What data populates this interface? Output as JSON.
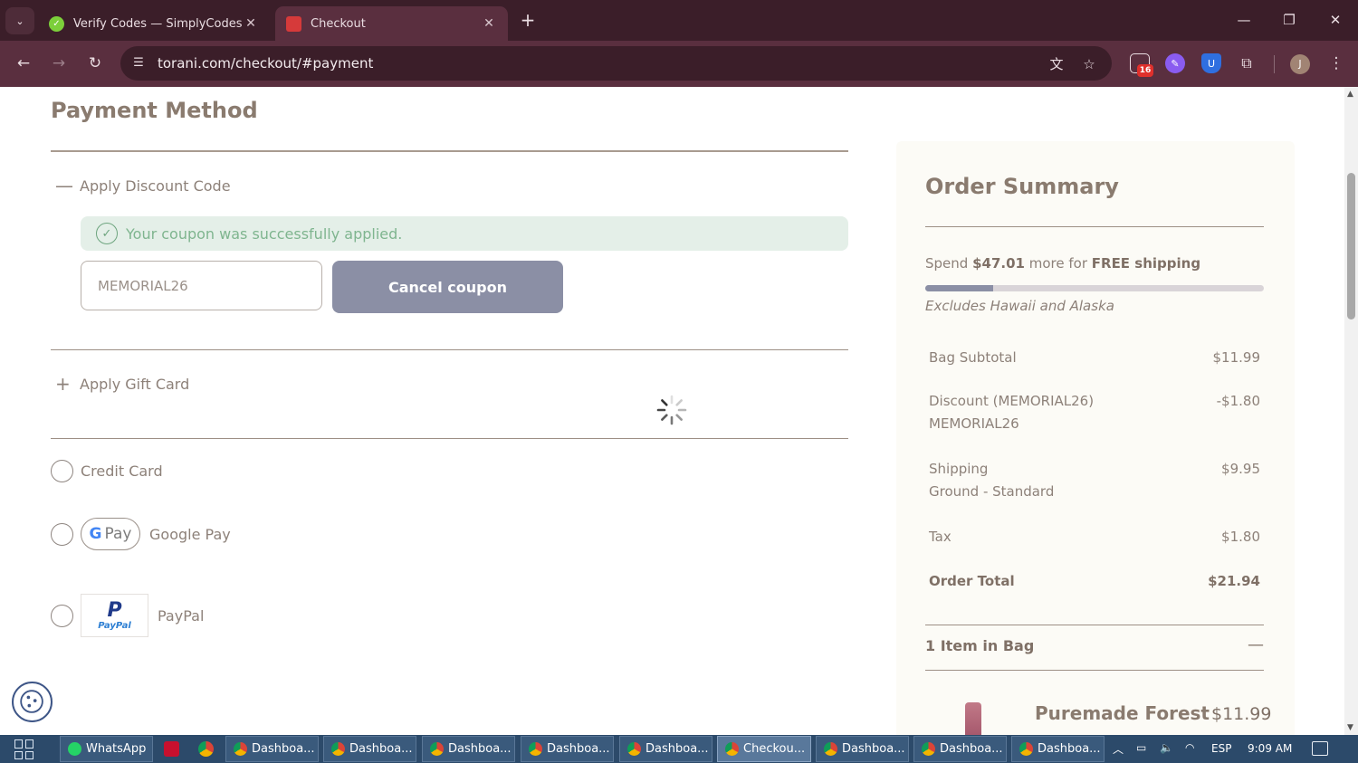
{
  "browser": {
    "tabs": [
      {
        "title": "Verify Codes — SimplyCodes",
        "active": false
      },
      {
        "title": "Checkout",
        "active": true
      }
    ],
    "url": "torani.com/checkout/#payment",
    "extension_badge": "16",
    "profile_initial": "J"
  },
  "payment": {
    "title": "Payment Method",
    "discount_toggle": "Apply Discount Code",
    "success_message": "Your coupon was successfully applied.",
    "coupon_value": "MEMORIAL26",
    "cancel_label": "Cancel coupon",
    "gift_card_toggle": "Apply Gift Card",
    "methods": [
      {
        "label": "Credit Card"
      },
      {
        "label": "Google Pay",
        "logo_text": "Pay"
      },
      {
        "label": "PayPal",
        "logo_text": "PayPal"
      }
    ]
  },
  "summary": {
    "title": "Order Summary",
    "shipping_prefix": "Spend ",
    "shipping_amount": "$47.01",
    "shipping_mid": " more for ",
    "shipping_free": "FREE shipping",
    "shipping_progress": 0.2,
    "excludes": "Excludes Hawaii and Alaska",
    "lines": [
      {
        "label": "Bag Subtotal",
        "sub": "",
        "value": "$11.99"
      },
      {
        "label": "Discount (MEMORIAL26)",
        "sub": "MEMORIAL26",
        "value": "-$1.80"
      },
      {
        "label": "Shipping",
        "sub": "Ground - Standard",
        "value": "$9.95"
      },
      {
        "label": "Tax",
        "sub": "",
        "value": "$1.80"
      }
    ],
    "total_label": "Order Total",
    "total_value": "$21.94",
    "items_heading": "1 Item in Bag",
    "items_toggle": "—",
    "product_name": "Puremade Forest",
    "product_price": "$11.99"
  },
  "taskbar": {
    "items": [
      {
        "label": "WhatsApp",
        "icon": "whatsapp-icon",
        "active": false
      },
      {
        "label": "Dashboa...",
        "icon": "chrome-icon",
        "active": false
      },
      {
        "label": "Dashboa...",
        "icon": "chrome-icon",
        "active": false
      },
      {
        "label": "Dashboa...",
        "icon": "chrome-icon",
        "active": false
      },
      {
        "label": "Dashboa...",
        "icon": "chrome-icon",
        "active": false
      },
      {
        "label": "Dashboa...",
        "icon": "chrome-icon",
        "active": false
      },
      {
        "label": "Checkou...",
        "icon": "chrome-icon",
        "active": true
      },
      {
        "label": "Dashboa...",
        "icon": "chrome-icon",
        "active": false
      },
      {
        "label": "Dashboa...",
        "icon": "chrome-icon",
        "active": false
      },
      {
        "label": "Dashboa...",
        "icon": "chrome-icon",
        "active": false
      }
    ],
    "language": "ESP",
    "time": "9:09 AM"
  },
  "colors": {
    "chrome_dark": "#3b1e29",
    "chrome_toolbar": "#5a2f3f",
    "button": "#8b8fa5",
    "text_brown": "#8a7b6f",
    "success_bg": "#e4efe8",
    "success_text": "#7fb58f",
    "taskbar": "#2c4a6a"
  }
}
